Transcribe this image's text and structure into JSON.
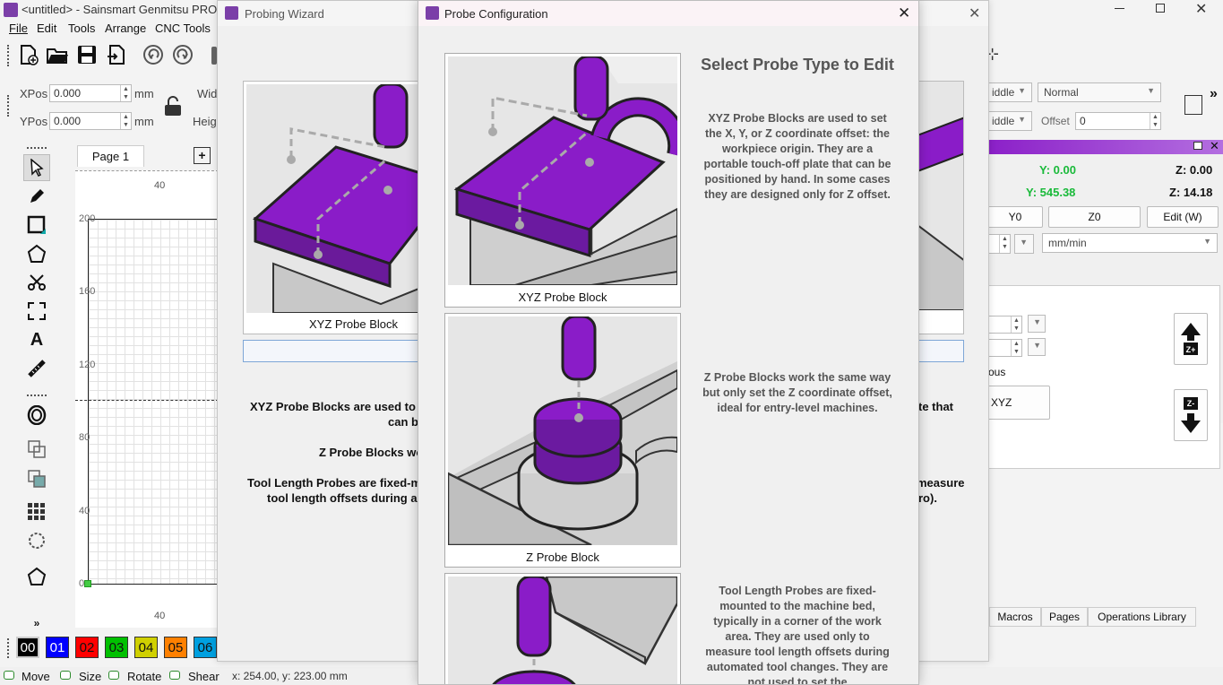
{
  "main_window": {
    "title": "<untitled> - Sainsmart Genmitsu PROVer",
    "menu": [
      "File",
      "Edit",
      "Tools",
      "Arrange",
      "CNC Tools"
    ],
    "xpos_label": "XPos",
    "xpos_value": "0.000",
    "ypos_label": "YPos",
    "ypos_value": "0.000",
    "unit": "mm",
    "width_label": "Widt",
    "height_label": "Heig",
    "page_tab": "Page 1",
    "ruler_top": "40",
    "ruler_bottom": "40",
    "ruler_left": [
      "200",
      "160",
      "120",
      "80",
      "40",
      "0"
    ],
    "palette": [
      {
        "label": "00",
        "bg": "#000000",
        "fg": "#ffffff"
      },
      {
        "label": "01",
        "bg": "#0000ff",
        "fg": "#ffffff"
      },
      {
        "label": "02",
        "bg": "#ff0000",
        "fg": "#000000"
      },
      {
        "label": "03",
        "bg": "#00c000",
        "fg": "#000000"
      },
      {
        "label": "04",
        "bg": "#d0d000",
        "fg": "#000000"
      },
      {
        "label": "05",
        "bg": "#ff8000",
        "fg": "#000000"
      },
      {
        "label": "06",
        "bg": "#00a0e0",
        "fg": "#000000"
      }
    ],
    "status_bar": {
      "move": "Move",
      "size": "Size",
      "rotate": "Rotate",
      "shear": "Shear",
      "coords": "x: 254.00, y: 223.00 mm"
    },
    "right_panel": {
      "combo1": "iddle",
      "combo2": "Normal",
      "combo3": "iddle",
      "offset_label": "Offset",
      "offset_value": "0",
      "y_pos1": "Y: 0.00",
      "z_pos1": "Z: 0.00",
      "y_pos2": "Y: 545.38",
      "z_pos2": "Z: 14.18",
      "btn_y0": "Y0",
      "btn_z0": "Z0",
      "btn_edit": "Edit (W)",
      "rate_unit": "mm/min",
      "continuous": "ous",
      "xyz_btn": "XYZ",
      "zplus": "Z+",
      "zminus": "Z-",
      "tabs": [
        "Macros",
        "Pages",
        "Operations Library"
      ]
    },
    "accent": "#8b1fc8"
  },
  "probing_wizard": {
    "title": "Probing Wizard",
    "card_label": "XYZ Probe Block",
    "text_line1": "XYZ Probe Blocks are used to s",
    "text_line1b": "can b",
    "text_line1_right": "te that",
    "text_line2": "Z Probe Blocks wo",
    "text_line3": "Tool Length Probes are fixed-m",
    "text_line3b": "tool length offsets during a",
    "text_line3_right": "measure",
    "text_line3b_right": "ro)."
  },
  "probe_config": {
    "title": "Probe Configuration",
    "heading": "Select Probe Type to Edit",
    "items": [
      {
        "label": "XYZ Probe Block",
        "description": "XYZ Probe Blocks are used to set the X, Y, or Z coordinate offset: the workpiece origin. They are a portable touch-off plate that can be positioned by hand. In some cases they are designed only for Z offset."
      },
      {
        "label": "Z Probe Block",
        "description": "Z Probe Blocks work the same way but only set the Z coordinate offset, ideal for entry-level machines."
      },
      {
        "label": "",
        "description": "Tool Length Probes are fixed-mounted to the machine bed, typically in a corner of the work area. They are used only to measure tool length offsets during automated tool changes. They are not used to set the"
      }
    ]
  }
}
